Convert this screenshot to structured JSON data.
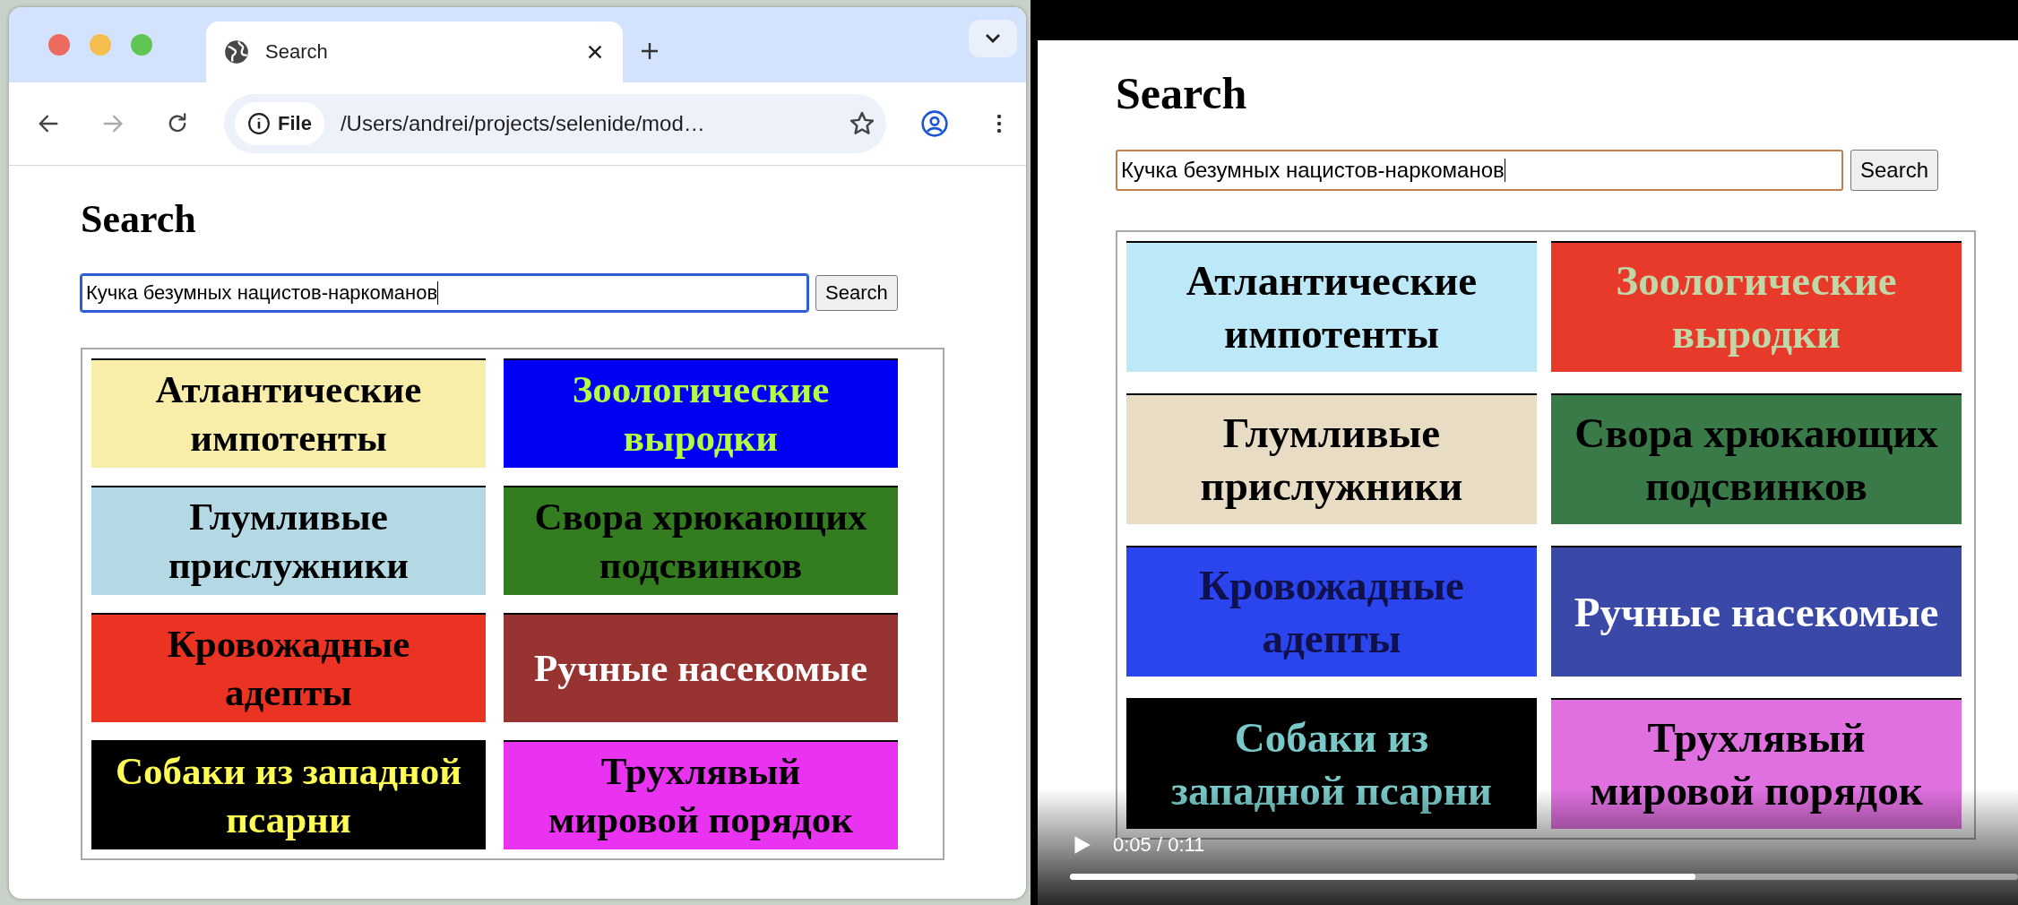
{
  "browser": {
    "tab": {
      "title": "Search"
    },
    "address": {
      "badge": "File",
      "url": "/Users/andrei/projects/selenide/mod…"
    }
  },
  "page": {
    "heading": "Search",
    "search": {
      "value": "Кучка безумных нацистов-наркоманов",
      "button": "Search"
    },
    "tiles": [
      {
        "label": "Атлантические импотенты",
        "color": "#f8eeaa",
        "ink": {
          "color": "#000000"
        }
      },
      {
        "label": "Зоологические выродки",
        "color": "#0000f5",
        "ink": {
          "color": "#b0ff40"
        }
      },
      {
        "label": "Глумливые прислужники",
        "color": "#b4d8e4",
        "ink": {
          "color": "#000000"
        }
      },
      {
        "label": "Свора хрюкающих подсвинков",
        "color": "#347c20",
        "ink": {
          "color": "#000000"
        }
      },
      {
        "label": "Кровожадные адепты",
        "color": "#ea3323",
        "ink": {
          "color": "#000000"
        }
      },
      {
        "label": "Ручные насекомые",
        "color": "#973330",
        "ink": {
          "color": "#ffffff"
        }
      },
      {
        "label": "Собаки из западной псарни",
        "color": "#000000",
        "ink": {
          "color": "#fffd54"
        }
      },
      {
        "label": "Трухлявый мировой порядок",
        "color": "#ea33f0",
        "ink": {
          "color": "#000000"
        }
      }
    ]
  },
  "video": {
    "page": {
      "heading": "Search",
      "search": {
        "value": "Кучка безумных нацистов-наркоманов",
        "button": "Search"
      },
      "tiles": [
        {
          "label": "Атлантические импотенты",
          "color": "#bce8f8",
          "ink": {
            "color": "#000000"
          }
        },
        {
          "label": "Зоологические выродки",
          "color": "#e83a2a",
          "ink": {
            "color": "#c0d8a8"
          }
        },
        {
          "label": "Глумливые прислужники",
          "color": "#e8dcc4",
          "ink": {
            "color": "#000000"
          }
        },
        {
          "label": "Свора хрюкающих подсвинков",
          "color": "#3a7a48",
          "ink": {
            "color": "#000000"
          }
        },
        {
          "label": "Кровожадные адепты",
          "color": "#2a44ee",
          "ink": {
            "color": "#10104a"
          }
        },
        {
          "label": "Ручные насекомые",
          "color": "#3a48a8",
          "ink": {
            "color": "#ffffff"
          }
        },
        {
          "label": "Собаки из западной псарни",
          "color": "#000000",
          "ink": {
            "color": "#78c8c8"
          }
        },
        {
          "label": "Трухлявый мировой порядок",
          "color": "#e070e0",
          "ink": {
            "color": "#000000"
          }
        }
      ]
    },
    "time": "0:05 / 0:11",
    "progress": {
      "level": 0.66
    }
  }
}
